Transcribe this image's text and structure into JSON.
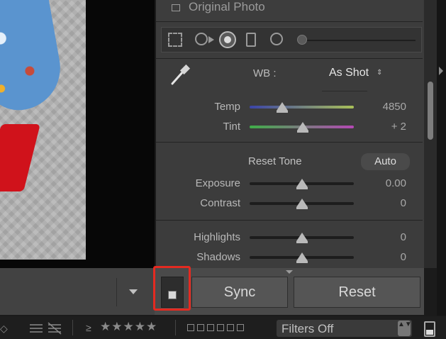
{
  "panel": {
    "original_photo_label": "Original Photo",
    "wb": {
      "label": "WB :",
      "value": "As Shot",
      "updown": "⇕"
    },
    "temp": {
      "label": "Temp",
      "value": "4850",
      "level": 0.31
    },
    "tint": {
      "label": "Tint",
      "value": "+ 2",
      "level": 0.51
    },
    "tone": {
      "reset_label": "Reset Tone",
      "auto_label": "Auto"
    },
    "exposure": {
      "label": "Exposure",
      "value": "0.00",
      "level": 0.5
    },
    "contrast": {
      "label": "Contrast",
      "value": "0",
      "level": 0.5
    },
    "highlights": {
      "label": "Highlights",
      "value": "0",
      "level": 0.5
    },
    "shadows": {
      "label": "Shadows",
      "value": "0",
      "level": 0.5
    }
  },
  "toolbar": {
    "sync_label": "Sync",
    "reset_label": "Reset"
  },
  "filmstrip": {
    "rating_prefix": "≥",
    "stars": "★★★★★",
    "filters_value": "Filters Off",
    "filters_updown": "▲▼"
  },
  "colors": {
    "highlight_frame": "#e42a21",
    "temp_gradient_start": "#3b44a8",
    "temp_gradient_end": "#a9c058",
    "tint_gradient_start": "#3fae48",
    "tint_gradient_end": "#b548b5"
  }
}
